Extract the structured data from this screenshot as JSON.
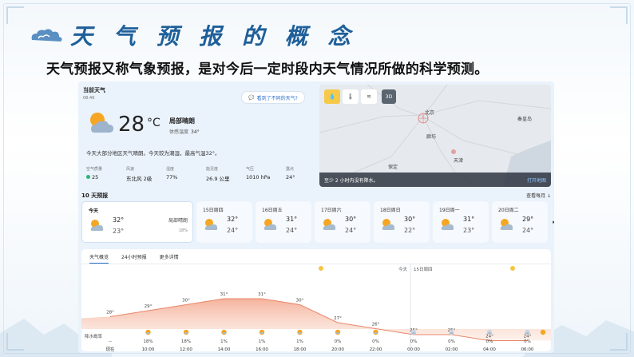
{
  "slide": {
    "title": "天 气 预 报 的 概 念",
    "subtitle": "天气预报又称气象预报，是对今后一定时段内天气情况所做的科学预测。"
  },
  "current": {
    "heading": "当前天气",
    "time": "08:46",
    "diff_button": "看到了不同的天气?",
    "temperature": "28",
    "unit": "°C",
    "condition": "局部晴朗",
    "feels_label": "体感温度",
    "feels_value": "34°",
    "description": "今天大部分地区天气晴朗。今天较为潮湿，最高气温32°。",
    "metrics": [
      {
        "label": "空气质量",
        "value": "25"
      },
      {
        "label": "风速",
        "value": "东北风 2级"
      },
      {
        "label": "湿度",
        "value": "77%"
      },
      {
        "label": "能见度",
        "value": "26.9 公里"
      },
      {
        "label": "气压",
        "value": "1010 hPa"
      },
      {
        "label": "露点",
        "value": "24°"
      }
    ]
  },
  "map": {
    "banner": "至少 2 小时内没有降水。",
    "open_link": "打开地图",
    "btn_3d": "3D",
    "places": [
      "北京",
      "秦皇岛",
      "廊坊",
      "保定",
      "天津"
    ]
  },
  "forecast": {
    "title": "10 天预报",
    "more_link": "查看每月 ↓",
    "days": [
      {
        "name": "今天",
        "high": "32°",
        "low": "23°",
        "cond": "局部晴朗",
        "precip": "18%"
      },
      {
        "name": "15日周四",
        "high": "32°",
        "low": "24°"
      },
      {
        "name": "16日周五",
        "high": "31°",
        "low": "24°"
      },
      {
        "name": "17日周六",
        "high": "30°",
        "low": "24°"
      },
      {
        "name": "18日周日",
        "high": "30°",
        "low": "22°"
      },
      {
        "name": "19日周一",
        "high": "31°",
        "low": "23°"
      },
      {
        "name": "20日周二",
        "high": "29°",
        "low": "24°"
      }
    ]
  },
  "hourly": {
    "tabs": [
      "天气概览",
      "24小时预报",
      "更多详情"
    ],
    "today_marker": "今天",
    "date_marker": "15日周四",
    "rain_label": "降水概率",
    "temps": [
      28,
      29,
      30,
      31,
      31,
      30,
      27,
      26,
      25,
      25,
      24,
      24
    ],
    "precip": [
      "--",
      "18%",
      "18%",
      "1%",
      "1%",
      "1%",
      "0%",
      "0%",
      "0%",
      "0%",
      "0%",
      "0%"
    ],
    "times": [
      "现在",
      "10:00",
      "12:00",
      "14:00",
      "16:00",
      "18:00",
      "20:00",
      "22:00",
      "00:00",
      "02:00",
      "04:00",
      "06:00"
    ]
  },
  "colors": {
    "title_blue": "#1f5f99",
    "accent_blue": "#2a6fc9",
    "sun": "#f5a623",
    "temp_fill": "#f7b9a1"
  }
}
